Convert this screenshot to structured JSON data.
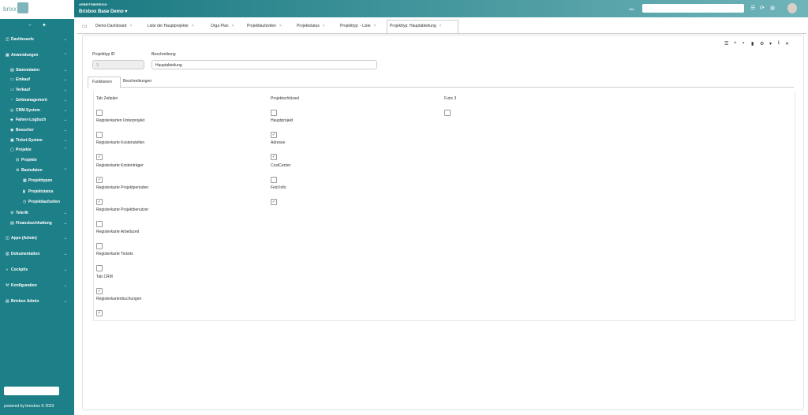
{
  "app": {
    "logo_text": "brixx"
  },
  "header": {
    "area_label": "ARBEITSBEREICH",
    "area_name": "Brixbox Base Demo",
    "search_label": "Alle"
  },
  "sidebar": {
    "items": [
      {
        "label": "Dashboards",
        "icon": "dashboard-icon"
      },
      {
        "label": "Anwendungen",
        "icon": "apps-icon"
      },
      {
        "label": "Stammdaten",
        "icon": "database-icon"
      },
      {
        "label": "Einkauf",
        "icon": "cart-icon"
      },
      {
        "label": "Verkauf",
        "icon": "cart-icon"
      },
      {
        "label": "Zeitmanagement",
        "icon": "clock-icon"
      },
      {
        "label": "CRM-System",
        "icon": "crm-icon"
      },
      {
        "label": "Fahrer-Logbuch",
        "icon": "car-icon"
      },
      {
        "label": "Besucher",
        "icon": "users-icon"
      },
      {
        "label": "Ticket-System",
        "icon": "ticket-icon"
      },
      {
        "label": "Projekte",
        "icon": "folder-icon"
      },
      {
        "label": "Projekte",
        "icon": "sitemap-icon"
      },
      {
        "label": "Basisdaten",
        "icon": "gear-icon"
      },
      {
        "label": "Projekttypen",
        "icon": "table-icon"
      },
      {
        "label": "Projektstatus",
        "icon": "bar-chart-icon"
      },
      {
        "label": "Projektlaufzeiten",
        "icon": "clock-icon"
      },
      {
        "label": "Telerik",
        "icon": "gear-icon"
      },
      {
        "label": "Finanzbuchhaltung",
        "icon": "finance-icon"
      },
      {
        "label": "Apps (Admin)",
        "icon": "apps-icon"
      },
      {
        "label": "Dokumentation",
        "icon": "book-icon"
      },
      {
        "label": "Cockpits",
        "icon": "cockpit-icon"
      },
      {
        "label": "Konfiguration",
        "icon": "wrench-icon"
      },
      {
        "label": "Brixbox Admin",
        "icon": "admin-icon"
      }
    ],
    "powered": "powered by brixxbox © 2023"
  },
  "tabs": [
    {
      "label": "Demo-Dashboard"
    },
    {
      "label": "Liste der Hauptprojekte"
    },
    {
      "label": "Orga Plan"
    },
    {
      "label": "Projektlaufzeiten"
    },
    {
      "label": "Projektstatus"
    },
    {
      "label": "Projekttyp: - Liste"
    },
    {
      "label": "Projekttyp: Hauptabteilung"
    }
  ],
  "form": {
    "id_label": "Projekttyp ID",
    "id_value": "3",
    "desc_label": "Beschreibung",
    "desc_value": "Hauptabteilung"
  },
  "subtabs": [
    {
      "label": "Funktionen"
    },
    {
      "label": "Beschreibungen"
    }
  ],
  "columns": {
    "col1": [
      {
        "label": "Tab Zeitplan",
        "checked": false
      },
      {
        "label": "Registerkarten Unterprojekt",
        "checked": false
      },
      {
        "label": "Registerkarte Kostenstellen",
        "checked": true
      },
      {
        "label": "Registerkarte Kostenträger",
        "checked": true
      },
      {
        "label": "Registerkarte Projektperioden",
        "checked": true
      },
      {
        "label": "Registerkarte Projektbenutzer",
        "checked": false
      },
      {
        "label": "Registerkarte Arbeitszeit",
        "checked": false
      },
      {
        "label": "Registerkarte Tickets",
        "checked": false
      },
      {
        "label": "Tab CRM",
        "checked": true
      },
      {
        "label": "Registerkartenbuchungen",
        "checked": true
      }
    ],
    "col2": [
      {
        "label": "Projektschlüssel",
        "checked": false
      },
      {
        "label": "Hauptprojekt",
        "checked": true
      },
      {
        "label": "Adresse",
        "checked": true
      },
      {
        "label": "CostCenter",
        "checked": false
      },
      {
        "label": "Feld Info",
        "checked": true
      }
    ],
    "col3": [
      {
        "label": "Func 3",
        "checked": false
      }
    ]
  }
}
